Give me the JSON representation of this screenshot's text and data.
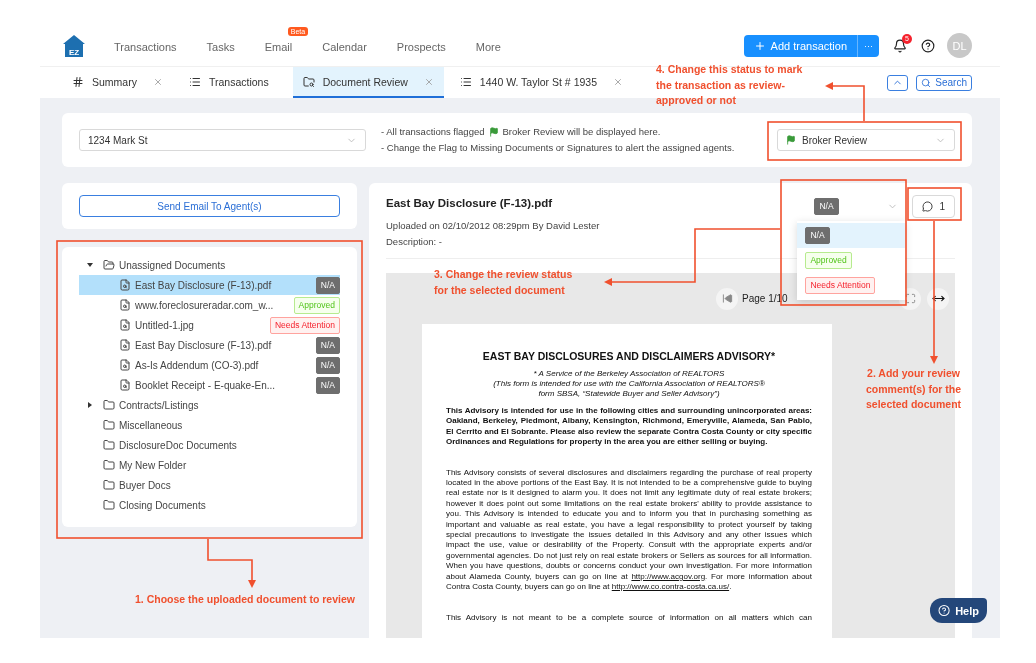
{
  "nav": {
    "logo": "EZ",
    "items": [
      {
        "label": "Transactions"
      },
      {
        "label": "Tasks"
      },
      {
        "label": "Email",
        "badge": "Beta"
      },
      {
        "label": "Calendar"
      },
      {
        "label": "Prospects"
      },
      {
        "label": "More"
      }
    ],
    "add_button": "Add transaction",
    "more_button": "···",
    "notifications": "5",
    "avatar": "DL"
  },
  "tabs": [
    {
      "label": "Summary",
      "closable": true,
      "selected": false
    },
    {
      "label": "Transactions",
      "closable": false,
      "selected": false
    },
    {
      "label": "Document Review",
      "closable": true,
      "selected": true
    },
    {
      "label": "1440 W. Taylor St # 1935",
      "closable": true,
      "selected": false
    }
  ],
  "tab_tools": {
    "search": "Search"
  },
  "filter": {
    "transaction": "1234 Mark St",
    "notes": [
      {
        "text": "- All transactions flagged",
        "after_flag": "Broker Review will be displayed here."
      },
      {
        "text": "- Change the Flag to Missing Documents or Signatures to alert the assigned agents."
      }
    ],
    "flag_status": "Broker Review"
  },
  "send_email": "Send Email To Agent(s)",
  "tree": [
    {
      "label": "Unassigned Documents",
      "expanded": true,
      "children": [
        {
          "label": "East Bay Disclosure (F-13).pdf",
          "selected": true,
          "status": {
            "label": "N/A",
            "kind": "na"
          }
        },
        {
          "label": "www.foreclosureradar.com_w...",
          "selected": false,
          "status": {
            "label": "Approved",
            "kind": "approved"
          }
        },
        {
          "label": "Untitled-1.jpg",
          "selected": false,
          "status": {
            "label": "Needs Attention",
            "kind": "attention"
          }
        },
        {
          "label": "East Bay Disclosure (F-13).pdf",
          "selected": false,
          "status": {
            "label": "N/A",
            "kind": "na"
          }
        },
        {
          "label": "As-Is Addendum (CO-3).pdf",
          "selected": false,
          "status": {
            "label": "N/A",
            "kind": "na"
          }
        },
        {
          "label": "Booklet Receipt - E-quake-En...",
          "selected": false,
          "status": {
            "label": "N/A",
            "kind": "na"
          }
        }
      ]
    },
    {
      "label": "Contracts/Listings",
      "expanded": false
    },
    {
      "label": "Miscellaneous"
    },
    {
      "label": "DisclosureDoc Documents"
    },
    {
      "label": "My New Folder"
    },
    {
      "label": "Buyer Docs"
    },
    {
      "label": "Closing Documents"
    }
  ],
  "document": {
    "title": "East Bay Disclosure (F-13).pdf",
    "uploaded": "Uploaded on 02/10/2012 08:29pm By David Lester",
    "description": "Description: -",
    "status": {
      "label": "N/A",
      "kind": "na"
    },
    "comments": "1",
    "status_menu": [
      {
        "label": "N/A",
        "kind": "na",
        "selected": true
      },
      {
        "label": "Approved",
        "kind": "approved",
        "selected": false
      },
      {
        "label": "Needs Attention",
        "kind": "attention",
        "selected": false
      }
    ],
    "page": "Page 1/10"
  },
  "pdf": {
    "title": "EAST BAY DISCLOSURES AND DISCLAIMERS ADVISORY*",
    "subtitle": [
      "* A Service of the Berkeley Association of REALTORS",
      "(This form is intended for use with the California Association of REALTORS®",
      "form SBSA, “Statewide Buyer and Seller Advisory”)"
    ],
    "paragraphs": [
      {
        "kind": "bold",
        "parts": [
          {
            "text": "This Advisory is intended for use in the following cities and surrounding unincorporated areas:  Oakland, Berkeley, Piedmont, Albany, Kensington, Richmond, Emeryville, Alameda, San Pablo, El Cerrito and El Sobrante.  Please also review the separate Contra Costa County or city specific Ordinances and Regulations for property in the area you are either selling or buying."
          }
        ]
      },
      {
        "kind": "plain",
        "parts": [
          {
            "text": "This Advisory consists of several disclosures and disclaimers regarding the purchase of real property located in the above portions of the East Bay.  It is not intended to be a comprehensive guide to buying real estate nor is it designed to alarm you.  It does not limit any legitimate duty of real estate brokers; however it does point out some limitations on the real estate brokers' ability to provide assistance to you. This Advisory is intended to educate you and to inform you that in purchasing something as important and valuable as real estate, you have a legal responsibility to protect yourself by taking special precautions to investigate the issues detailed in this Advisory and any other issues which impact the use, value or desirability of the Property.  Consult with the appropriate experts and/or governmental agencies.  Do not just rely on real estate brokers or Sellers as sources for all information.  When you have questions, doubts or concerns conduct your own investigation.  For more information about Alameda County, buyers can go on line at "
          },
          {
            "text": "http://www.acgov.org",
            "link": true
          },
          {
            "text": ".  For more information about Contra Costa County, buyers can go on line at "
          },
          {
            "text": "http://www.co.contra-costa.ca.us/",
            "link": true
          },
          {
            "text": "."
          }
        ]
      },
      {
        "kind": "cut",
        "parts": [
          {
            "text": "This Advisory is not meant to be a complete source of information on all matters which can"
          }
        ]
      }
    ]
  },
  "help": "Help",
  "annotations": [
    {
      "lines": [
        "1. Choose the uploaded document to review"
      ]
    },
    {
      "lines": [
        "2. Add your review",
        "comment(s) for the",
        "selected document"
      ]
    },
    {
      "lines": [
        "3. Change the review status",
        "for the selected document"
      ]
    },
    {
      "lines": [
        "4. Change this status to mark",
        "the transaction as review-",
        "approved or not"
      ]
    }
  ]
}
